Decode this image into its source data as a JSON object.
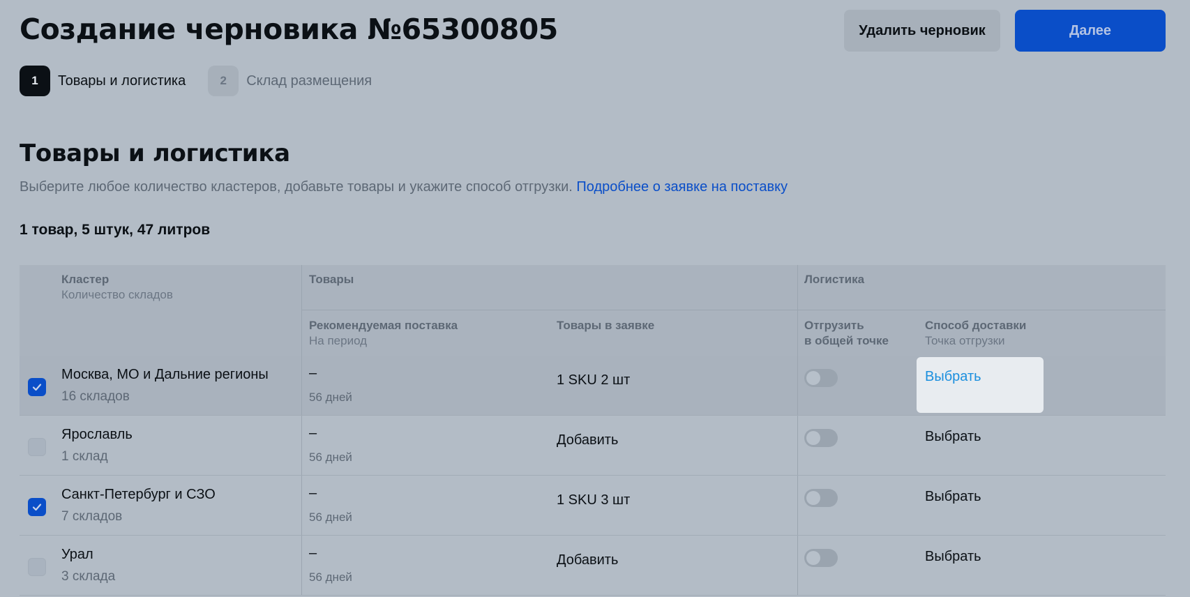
{
  "header": {
    "title": "Создание черновика №65300805",
    "delete_label": "Удалить черновик",
    "next_label": "Далее"
  },
  "steps": [
    {
      "num": "1",
      "label": "Товары и логистика",
      "active": true
    },
    {
      "num": "2",
      "label": "Склад размещения",
      "active": false
    }
  ],
  "section": {
    "title": "Товары и логистика",
    "description": "Выберите любое количество кластеров, добавьте товары и укажите способ отгрузки.",
    "link": "Подробнее о заявке на поставку",
    "summary": "1 товар, 5 штук, 47 литров"
  },
  "table": {
    "headers": {
      "cluster": "Кластер",
      "cluster_sub": "Количество складов",
      "goods": "Товары",
      "logistics": "Логистика",
      "recommended": "Рекомендуемая поставка",
      "recommended_sub": "На период",
      "in_request": "Товары в заявке",
      "ship_common_line1": "Отгрузить",
      "ship_common_line2": "в общей точке",
      "delivery_method": "Способ доставки",
      "delivery_method_sub": "Точка отгрузки"
    },
    "rows": [
      {
        "checked": true,
        "name": "Москва, МО и Дальние регионы",
        "count": "16 складов",
        "recommended": "–",
        "period": "56 дней",
        "goods": "1 SKU 2 шт",
        "delivery": "Выбрать",
        "highlight": true
      },
      {
        "checked": false,
        "name": "Ярославль",
        "count": "1 склад",
        "recommended": "–",
        "period": "56 дней",
        "goods": "Добавить",
        "delivery": "Выбрать",
        "highlight": false
      },
      {
        "checked": true,
        "name": "Санкт-Петербург и СЗО",
        "count": "7 складов",
        "recommended": "–",
        "period": "56 дней",
        "goods": "1 SKU 3 шт",
        "delivery": "Выбрать",
        "highlight": false
      },
      {
        "checked": false,
        "name": "Урал",
        "count": "3 склада",
        "recommended": "–",
        "period": "56 дней",
        "goods": "Добавить",
        "delivery": "Выбрать",
        "highlight": false
      }
    ]
  },
  "colors": {
    "background": "#b3bcc6",
    "accent": "#0a4ec8",
    "link_highlight": "#1b8fde"
  }
}
